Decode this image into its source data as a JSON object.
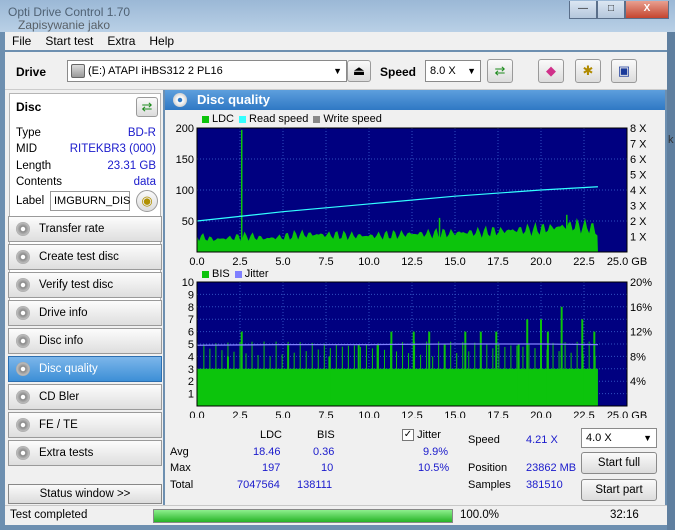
{
  "window": {
    "title": "Opti Drive Control 1.70",
    "background_title": "Zapisywanie jako",
    "controls": {
      "minimize": "—",
      "maximize": "□",
      "close": "X"
    }
  },
  "menu": [
    "File",
    "Start test",
    "Extra",
    "Help"
  ],
  "toolbar": {
    "drive_label": "Drive",
    "drive_value": "(E:)  ATAPI iHBS312  2 PL16",
    "speed_label": "Speed",
    "speed_value": "8.0 X",
    "icons": [
      "eject-icon",
      "refresh-icon",
      "eraser-icon",
      "config-icon",
      "save-icon"
    ]
  },
  "disc": {
    "header": "Disc",
    "rows": [
      {
        "k": "Type",
        "v": "BD-R"
      },
      {
        "k": "MID",
        "v": "RITEKBR3 (000)"
      },
      {
        "k": "Length",
        "v": "23.31 GB"
      },
      {
        "k": "Contents",
        "v": "data"
      }
    ],
    "label_key": "Label",
    "label_value": "IMGBURN_DIS"
  },
  "nav": [
    {
      "label": "Transfer rate",
      "active": false
    },
    {
      "label": "Create test disc",
      "active": false
    },
    {
      "label": "Verify test disc",
      "active": false
    },
    {
      "label": "Drive info",
      "active": false
    },
    {
      "label": "Disc info",
      "active": false
    },
    {
      "label": "Disc quality",
      "active": true
    },
    {
      "label": "CD Bler",
      "active": false
    },
    {
      "label": "FE / TE",
      "active": false
    },
    {
      "label": "Extra tests",
      "active": false
    }
  ],
  "status_window_label": "Status window >>",
  "main_title": "Disc quality",
  "chart_data": [
    {
      "type": "area",
      "legend": [
        "LDC",
        "Read speed",
        "Write speed"
      ],
      "colors": {
        "LDC": "#0cc40c",
        "Read speed": "#33ffff",
        "Write speed": "#888888",
        "bg": "#000080"
      },
      "x_ticks": [
        "0.0",
        "2.5",
        "5.0",
        "7.5",
        "10.0",
        "12.5",
        "15.0",
        "17.5",
        "20.0",
        "22.5",
        "25.0 GB"
      ],
      "xlim": [
        0,
        25
      ],
      "y_ticks_left": [
        "200",
        "150",
        "100",
        "50"
      ],
      "ylim_left": [
        0,
        200
      ],
      "y_ticks_right": [
        "8 X",
        "7 X",
        "6 X",
        "5 X",
        "4 X",
        "3 X",
        "2 X",
        "1 X"
      ],
      "ylim_right": [
        0,
        8
      ],
      "ldc_profile": {
        "x": [
          0,
          1,
          2,
          3,
          4,
          5,
          6,
          8,
          10,
          12,
          14,
          16,
          18,
          20,
          22,
          23,
          23.31
        ],
        "y": [
          18,
          14,
          16,
          18,
          15,
          17,
          20,
          19,
          18,
          20,
          21,
          22,
          24,
          26,
          30,
          28,
          20
        ]
      },
      "ldc_spikes": {
        "x": [
          2.6,
          14.1,
          21.5
        ],
        "y": [
          197,
          55,
          60
        ]
      },
      "read_speed": {
        "x": [
          0,
          5,
          10,
          15,
          20,
          23.31
        ],
        "y": [
          2.0,
          2.6,
          3.1,
          3.6,
          4.0,
          4.21
        ]
      }
    },
    {
      "type": "area",
      "legend": [
        "BIS",
        "Jitter"
      ],
      "colors": {
        "BIS": "#0cc40c",
        "Jitter": "#8080ff",
        "bg": "#000080"
      },
      "x_ticks": [
        "0.0",
        "2.5",
        "5.0",
        "7.5",
        "10.0",
        "12.5",
        "15.0",
        "17.5",
        "20.0",
        "22.5",
        "25.0 GB"
      ],
      "xlim": [
        0,
        25
      ],
      "y_ticks_left": [
        "10",
        "9",
        "8",
        "7",
        "6",
        "5",
        "4",
        "3",
        "2",
        "1"
      ],
      "ylim_left": [
        0,
        10
      ],
      "y_ticks_right": [
        "20%",
        "16%",
        "12%",
        "8%",
        "4%"
      ],
      "ylim_right": [
        0,
        20
      ],
      "bis_base": 3,
      "bis_spikes": {
        "x": [
          1.8,
          2.6,
          5.3,
          7.7,
          9.4,
          10.5,
          11.3,
          12.6,
          13.5,
          14.4,
          15.6,
          16.5,
          17.4,
          18.7,
          19.2,
          20.0,
          20.4,
          21.2,
          22.4,
          23.1
        ],
        "y": [
          4,
          6,
          5,
          4,
          5,
          5,
          6,
          6,
          6,
          5,
          6,
          6,
          6,
          5,
          7,
          7,
          6,
          8,
          7,
          6
        ]
      },
      "jitter": {
        "x": [
          0,
          5,
          10,
          15,
          20,
          23.31
        ],
        "y": [
          9.8,
          9.9,
          9.9,
          10.0,
          10.0,
          9.9
        ]
      }
    }
  ],
  "stats": {
    "headers": [
      "LDC",
      "BIS"
    ],
    "jitter_label": "Jitter",
    "jitter_checked": "✓",
    "rows": [
      {
        "label": "Avg",
        "ldc": "18.46",
        "bis": "0.36",
        "jitter": "9.9%"
      },
      {
        "label": "Max",
        "ldc": "197",
        "bis": "10",
        "jitter": "10.5%"
      },
      {
        "label": "Total",
        "ldc": "7047564",
        "bis": "138111",
        "jitter": ""
      }
    ],
    "speed_label": "Speed",
    "speed_value": "4.21 X",
    "position_label": "Position",
    "position_value": "23862 MB",
    "samples_label": "Samples",
    "samples_value": "381510",
    "speed_select": "4.0 X",
    "start_full": "Start full",
    "start_part": "Start part"
  },
  "statusbar": {
    "text": "Test completed",
    "progress": 100,
    "progress_text": "100.0%",
    "time": "32:16"
  },
  "background_right_char": "k"
}
